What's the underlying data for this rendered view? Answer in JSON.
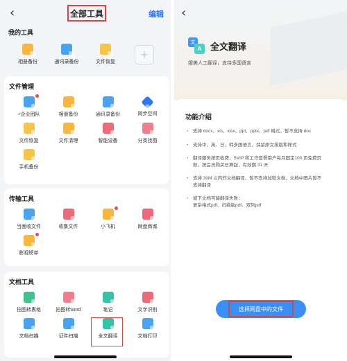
{
  "left": {
    "back_icon": "chevron-left-icon",
    "title": "全部工具",
    "edit_label": "编辑",
    "my_tools": {
      "title": "我的工具",
      "items": [
        {
          "label": "相册备份",
          "icon": "photo-backup-icon",
          "color": "#f6b73c"
        },
        {
          "label": "通讯录备份",
          "icon": "contacts-backup-icon",
          "color": "#4aa3f0"
        },
        {
          "label": "文件恢复",
          "icon": "file-restore-icon",
          "color": "#f7c545"
        }
      ],
      "add_icon": "plus-icon"
    },
    "file_mgmt": {
      "title": "文件管理",
      "items": [
        {
          "label": "+企业团队"
        },
        {
          "label": "相册备份"
        },
        {
          "label": "通讯录备份"
        },
        {
          "label": "同步空间"
        },
        {
          "label": "文件恢复"
        },
        {
          "label": "文件清理"
        },
        {
          "label": "智能设备"
        },
        {
          "label": "分类找图"
        },
        {
          "label": "手机备份"
        }
      ]
    },
    "transfer": {
      "title": "传输工具",
      "items": [
        {
          "label": "当面收文件"
        },
        {
          "label": "收集文件"
        },
        {
          "label": "小飞机"
        },
        {
          "label": "网盘商城"
        },
        {
          "label": "影视榜单"
        }
      ]
    },
    "doc_tools": {
      "title": "文档工具",
      "items": [
        {
          "label": "拍图转表格"
        },
        {
          "label": "拍图转word"
        },
        {
          "label": "笔记"
        },
        {
          "label": "文字识别"
        },
        {
          "label": "文档扫描"
        },
        {
          "label": "证件扫描"
        },
        {
          "label": "全文翻译"
        },
        {
          "label": "文档打印"
        }
      ]
    }
  },
  "right": {
    "back_icon": "chevron-left-icon",
    "title": "全文翻译",
    "subtitle": "媲美人工翻译，支持多国语言",
    "icon_glyph_a": "文",
    "icon_glyph_b": "A",
    "section_title": "功能介绍",
    "bullets": [
      [
        "支持 docx、xls、xlsx、ppt、pptx、pdf 格式，暂不支持 doc"
      ],
      [
        "支持中、英、日、韩多国语言，保留原文排版和样式"
      ],
      [
        "翻译服务按页收费，SVIP 和工作套餐用户每月固定100 页免费页",
        "数，按会员购买日算起，有效期 31 天"
      ],
      [
        "支持 30M 以内的文档翻译，暂不支持加密文档，文档中图片暂不",
        "支持翻译"
      ],
      [
        "如下文档可能翻译失败：",
        "复杂格式pdf、扫描版pdf、双列pdf"
      ]
    ],
    "button_label": "选择网盘中的文件",
    "accent": "#3b8ef3"
  }
}
